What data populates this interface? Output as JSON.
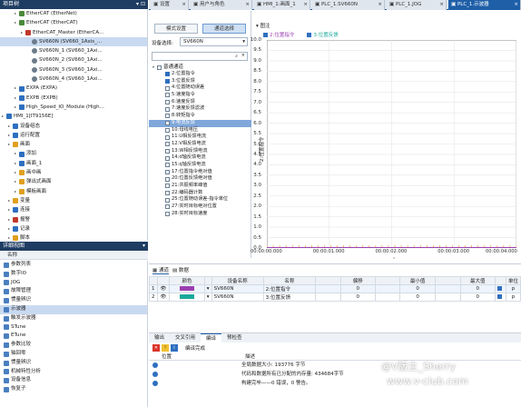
{
  "project_tree": {
    "header": "项目树",
    "rows": [
      {
        "label": "EtherCAT (EtherNet)",
        "level": 2,
        "icon": "network-icon",
        "color": "#4a8a3a"
      },
      {
        "label": "EtherCAT (EtherCAT)",
        "level": 2,
        "icon": "network-icon",
        "color": "#4a8a3a"
      },
      {
        "label": "EtherCAT_Master (EtherCA...",
        "level": 3,
        "icon": "master-icon",
        "color": "#c0392b"
      },
      {
        "label": "SV660N (SV660_1Axis_...",
        "level": 4,
        "icon": "gear-icon",
        "color": "#6b7b8a",
        "selected": true
      },
      {
        "label": "SV660N_1 (SV660_1Axi...",
        "level": 4,
        "icon": "gear-icon",
        "color": "#6b7b8a"
      },
      {
        "label": "SV660N_2 (SV660_1Axi...",
        "level": 4,
        "icon": "gear-icon",
        "color": "#6b7b8a"
      },
      {
        "label": "SV660N_3 (SV660_1Axi...",
        "level": 4,
        "icon": "gear-icon",
        "color": "#6b7b8a"
      },
      {
        "label": "SV660N_4 (SV660_1Axi...",
        "level": 4,
        "icon": "gear-icon",
        "color": "#6b7b8a"
      },
      {
        "label": "EXPA (EXPA)",
        "level": 2,
        "icon": "module-icon",
        "color": "#2e6fc0"
      },
      {
        "label": "EXPB (EXPB)",
        "level": 2,
        "icon": "module-icon",
        "color": "#2e6fc0"
      },
      {
        "label": "High_Speed_IO_Module (High...",
        "level": 2,
        "icon": "module-icon",
        "color": "#2e6fc0"
      },
      {
        "label": "HMI_1[IT9156E]",
        "level": 0,
        "icon": "hmi-icon",
        "color": "#2e6fc0"
      },
      {
        "label": "设备组态",
        "level": 1,
        "icon": "config-icon",
        "color": "#2e6fc0"
      },
      {
        "label": "运行配置",
        "level": 1,
        "icon": "run-icon",
        "color": "#2e6fc0"
      },
      {
        "label": "画面",
        "level": 1,
        "icon": "folder-icon",
        "color": "#e0a020"
      },
      {
        "label": "添加",
        "level": 2,
        "icon": "add-icon",
        "color": "#2e6fc0"
      },
      {
        "label": "画面_1",
        "level": 2,
        "icon": "screen-icon",
        "color": "#2e6fc0"
      },
      {
        "label": "画中画",
        "level": 2,
        "icon": "folder-icon",
        "color": "#e0a020"
      },
      {
        "label": "弹出式画面",
        "level": 2,
        "icon": "folder-icon",
        "color": "#e0a020"
      },
      {
        "label": "模板画面",
        "level": 2,
        "icon": "folder-icon",
        "color": "#e0a020"
      },
      {
        "label": "变量",
        "level": 1,
        "icon": "folder-icon",
        "color": "#e0a020"
      },
      {
        "label": "连接",
        "level": 1,
        "icon": "link-icon",
        "color": "#2e6fc0"
      },
      {
        "label": "报警",
        "level": 1,
        "icon": "alarm-icon",
        "color": "#c0392b"
      },
      {
        "label": "记录",
        "level": 1,
        "icon": "record-icon",
        "color": "#2e6fc0"
      },
      {
        "label": "脚本",
        "level": 1,
        "icon": "folder-icon",
        "color": "#e0a020"
      }
    ]
  },
  "detail": {
    "header": "详细视图",
    "col_header": "名称",
    "rows": [
      "参数列表",
      "数字IO",
      "JOG",
      "故障管理",
      "惯量辨识",
      "示波器",
      "触发示波器",
      "STune",
      "ETune",
      "参数比较",
      "轴回零",
      "惯量辨识",
      "机械特性分析",
      "设备信息",
      "恢复子"
    ],
    "selected_index": 5
  },
  "tabs": [
    {
      "label": "设置",
      "active": false
    },
    {
      "label": "用户与角色",
      "active": false
    },
    {
      "label": "HMI_1:画面_1",
      "active": false
    },
    {
      "label": "PLC_1.SV660N",
      "active": false
    },
    {
      "label": "PLC_1.JOG",
      "active": false
    },
    {
      "label": "PLC_1.示波器",
      "active": true
    }
  ],
  "scope": {
    "mode_btn": "模式设置",
    "channel_btn": "通道选择",
    "device_label": "设备选择:",
    "device_value": "SV660N",
    "search_placeholder": "",
    "group_label": "普通通道",
    "channels": [
      {
        "label": "2:位置指令",
        "checked": true
      },
      {
        "label": "3:位置反馈",
        "checked": true
      },
      {
        "label": "4:位置随动误差",
        "checked": false
      },
      {
        "label": "5:速度指令",
        "checked": false
      },
      {
        "label": "6:速度反馈",
        "checked": false
      },
      {
        "label": "7:速度反馈滤波",
        "checked": false
      },
      {
        "label": "8:转矩指令",
        "checked": false
      },
      {
        "label": "9:电流反馈",
        "checked": false,
        "selected": true
      },
      {
        "label": "10:母线电压",
        "checked": false
      },
      {
        "label": "11:U相反馈电流",
        "checked": false
      },
      {
        "label": "12:V相反馈电流",
        "checked": false
      },
      {
        "label": "13:W相反馈电流",
        "checked": false
      },
      {
        "label": "14:d轴反馈电流",
        "checked": false
      },
      {
        "label": "15:q轴反馈电流",
        "checked": false
      },
      {
        "label": "17:位置指令绝对值",
        "checked": false
      },
      {
        "label": "20:位置反馈绝对值",
        "checked": false
      },
      {
        "label": "21:共振频率峰值",
        "checked": false
      },
      {
        "label": "22:编码器计数",
        "checked": false
      },
      {
        "label": "25:位置随动误差-指令单位",
        "checked": false
      },
      {
        "label": "27:实时目标绝对位置",
        "checked": false
      },
      {
        "label": "28:实时目标速度",
        "checked": false
      }
    ],
    "legend_title": "图注",
    "legend": [
      {
        "label": "2:位置指令",
        "color": "#9b3fb0"
      },
      {
        "label": "3:位置反馈",
        "color": "#1aa89a"
      }
    ]
  },
  "chart_data": {
    "type": "line",
    "ylabel": "2:位置指令",
    "yticks": [
      "10.0",
      "9.5",
      "9.0",
      "8.5",
      "8.0",
      "7.5",
      "7.0",
      "6.5",
      "6.0",
      "5.5",
      "5.0",
      "4.5",
      "4.0",
      "3.5",
      "3.0",
      "2.5",
      "2.0",
      "1.5",
      "1.0",
      "0.5",
      "0.0"
    ],
    "ylim": [
      0,
      10
    ],
    "xticks": [
      "00:00:00.000",
      "00:00:01.000",
      "00:00:02.000",
      "00:00:03.000",
      "00:00:04.000"
    ],
    "series": [
      {
        "name": "2:位置指令",
        "values": []
      },
      {
        "name": "3:位置反馈",
        "values": []
      }
    ],
    "grid": true
  },
  "channel_table": {
    "tabs": [
      "通道",
      "数据"
    ],
    "headers": [
      "",
      "",
      "颜色",
      "",
      "设备名称",
      "名称",
      "",
      "偏移",
      "",
      "最小值",
      "",
      "最大值",
      "",
      "单位"
    ],
    "rows": [
      {
        "num": "1",
        "color": "#9b3fb0",
        "device": "SV660N",
        "name": "2:位置指令",
        "offset": "0",
        "min": "0",
        "max": "0",
        "unit": "p"
      },
      {
        "num": "2",
        "color": "#1aa89a",
        "device": "SV660N",
        "name": "3:位置反馈",
        "offset": "0",
        "min": "0",
        "max": "0",
        "unit": "p"
      }
    ]
  },
  "output": {
    "tabs": [
      {
        "label": "输出",
        "active": false
      },
      {
        "label": "交叉引用",
        "active": false
      },
      {
        "label": "编译",
        "active": true
      },
      {
        "label": "预检查",
        "active": false
      }
    ],
    "status": "编译完成",
    "col_pos": "位置",
    "col_desc": "描述",
    "lines": [
      "全局数据大小: 193776 字节",
      "代码和数据所有已分配的内存量: 434684字节",
      "构建完毕——0 错误，0 警告。"
    ]
  },
  "watermark": {
    "line1": "@V版主_Sherry",
    "line2": "www.v-club.com"
  }
}
